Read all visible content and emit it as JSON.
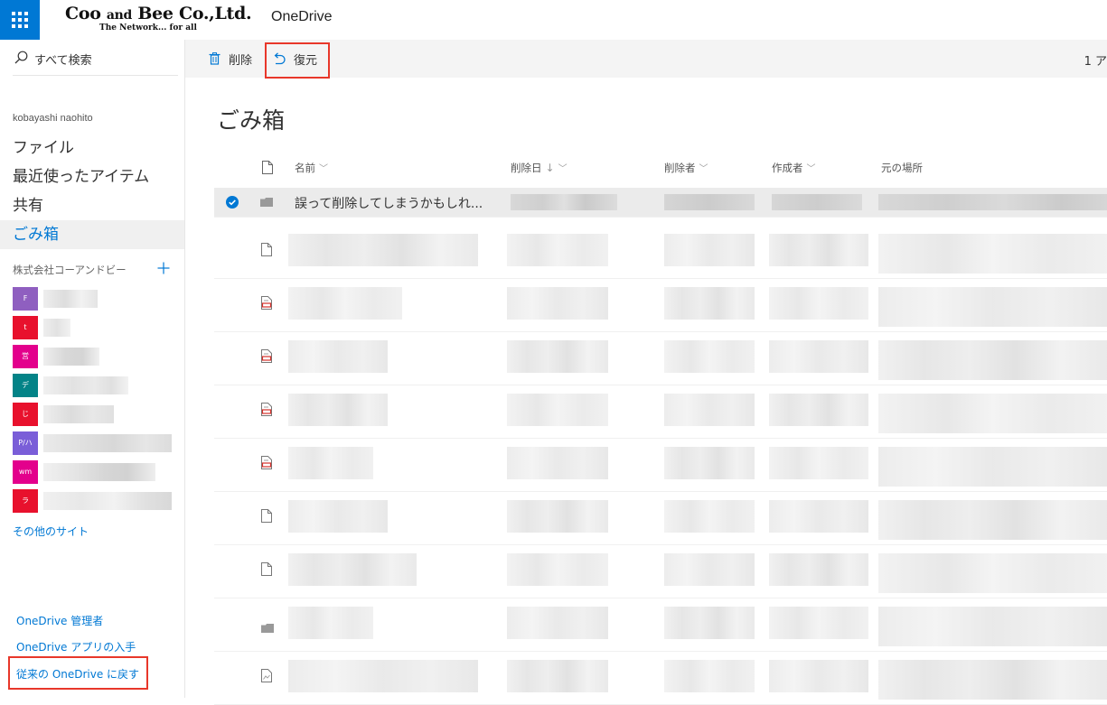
{
  "topbar": {
    "logo_name_a": "Coo ",
    "logo_name_and": "and",
    "logo_name_b": " Bee Co.,Ltd.",
    "logo_tagline": "The Network... for all",
    "app_name": "OneDrive"
  },
  "sidebar": {
    "search_label": "すべて検索",
    "user_name": "kobayashi naohito",
    "nav": [
      {
        "label": "ファイル"
      },
      {
        "label": "最近使ったアイテム"
      },
      {
        "label": "共有"
      },
      {
        "label": "ごみ箱",
        "active": true
      }
    ],
    "group_title": "株式会社コーアンドビー",
    "sites": [
      {
        "badge": "F",
        "color": "#8f5fc0"
      },
      {
        "badge": "t",
        "color": "#e8112d"
      },
      {
        "badge": "営",
        "color": "#e3008c"
      },
      {
        "badge": "デ",
        "color": "#038387"
      },
      {
        "badge": "じ",
        "color": "#e8112d"
      },
      {
        "badge": "P/ハ",
        "color": "#7a5ed8"
      },
      {
        "badge": "wm",
        "color": "#e3008c"
      },
      {
        "badge": "ラ",
        "color": "#e8112d"
      }
    ],
    "more_sites": "その他のサイト",
    "footer_links": [
      {
        "label": "OneDrive 管理者"
      },
      {
        "label": "OneDrive アプリの入手"
      },
      {
        "label": "従来の OneDrive に戻す"
      }
    ]
  },
  "commandbar": {
    "delete_label": "削除",
    "restore_label": "復元",
    "count_text": "1 ア"
  },
  "main": {
    "title": "ごみ箱",
    "columns": {
      "name": "名前",
      "deleted_date": "削除日",
      "deleted_by": "削除者",
      "created_by": "作成者",
      "original_location": "元の場所"
    },
    "selected_row_name": "誤って削除してしまうかもしれ...",
    "rows": [
      {
        "type": "file"
      },
      {
        "type": "pdf"
      },
      {
        "type": "pdf"
      },
      {
        "type": "pdf"
      },
      {
        "type": "pdf"
      },
      {
        "type": "file"
      },
      {
        "type": "file"
      },
      {
        "type": "folder"
      },
      {
        "type": "image"
      }
    ]
  },
  "colors": {
    "accent": "#0078d4",
    "highlight_box": "#e8372a"
  }
}
